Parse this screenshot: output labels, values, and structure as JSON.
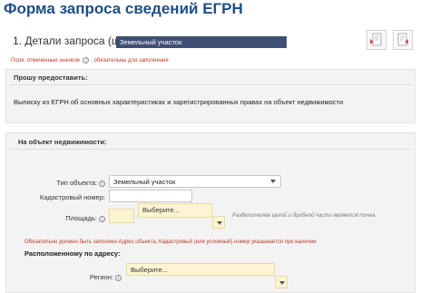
{
  "header": {
    "title": "Форма запроса сведений ЕГРН"
  },
  "step": {
    "title": "1. Детали запроса (ш",
    "tooltip": "Земельный участок"
  },
  "icons": {
    "doc1": "document-icon",
    "doc2": "document-icon"
  },
  "required_note": {
    "text": "Поля, отмеченные значком",
    "info_glyph": "i",
    "suffix": ", обязательны для заполнения"
  },
  "provide_section": {
    "title": "Прошу предоставить:",
    "text": "Выписку из ЕГРН об основных характеристиках и зарегистрированных правах на объект недвижимости"
  },
  "property_section": {
    "title": "На объект недвижимости:",
    "object_type": {
      "label": "Тип объекта:",
      "value": "Земельный участок"
    },
    "cadastral_number": {
      "label": "Кадастровый номер:",
      "value": ""
    },
    "area": {
      "label": "Площадь:",
      "unit_placeholder": "Выберите...",
      "hint": "Разделителем целой и дробной части является точка"
    },
    "error_note": "Обязательно должен быть заполнен Адрес объекта, Кадастровый (или условный) номер указывается при наличии",
    "address": {
      "title": "Расположенному по адресу:",
      "region_label": "Регион:",
      "region_placeholder": "Выберите..."
    }
  }
}
